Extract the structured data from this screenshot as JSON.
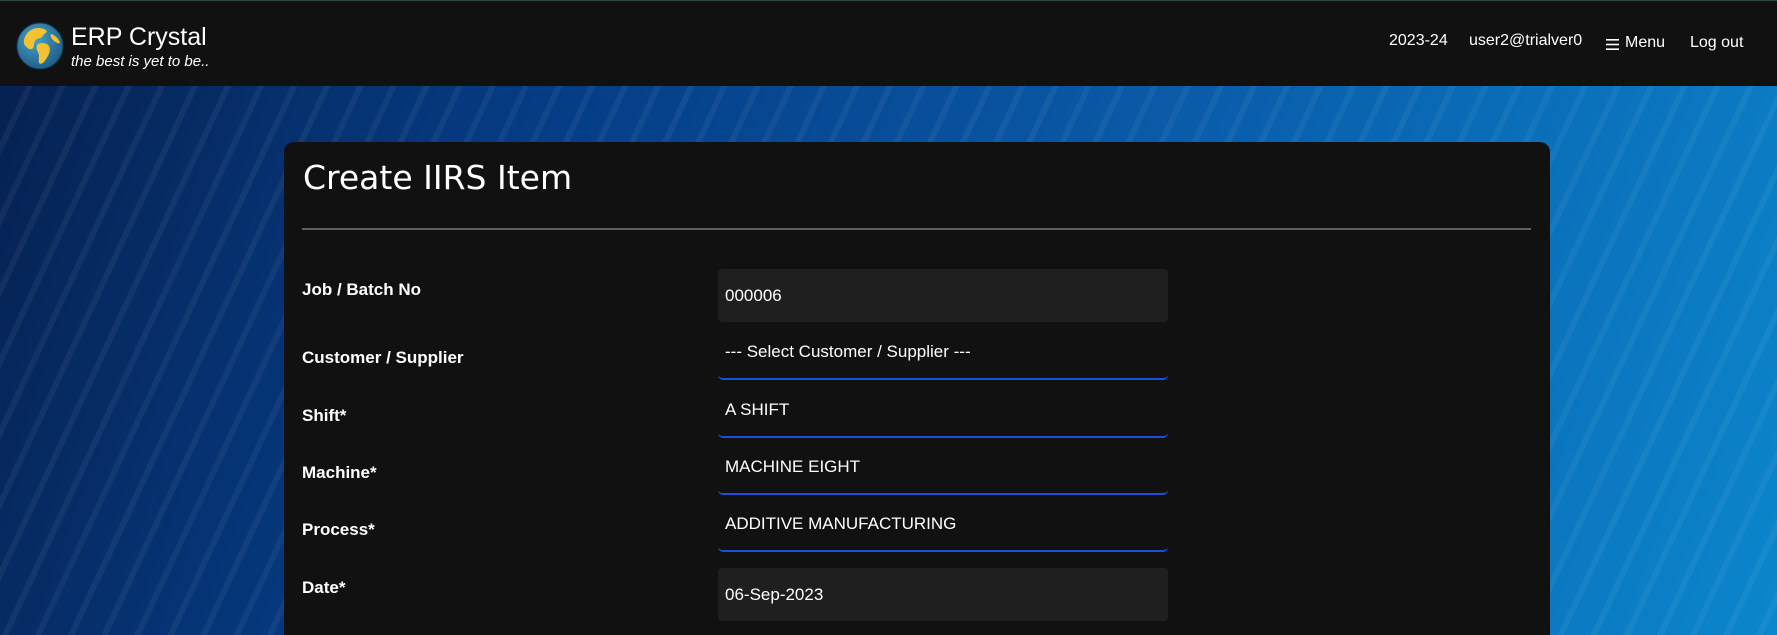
{
  "header": {
    "brand_title": "ERP Crystal",
    "brand_tagline": "the best is yet to be..",
    "logo_icon": "globe-icon",
    "financial_year": "2023-24",
    "user": "user2@trialver0",
    "menu_label": "Menu",
    "menu_icon": "hamburger-icon",
    "logout_label": "Log out"
  },
  "form": {
    "title": "Create IIRS Item",
    "fields": {
      "job_batch_no": {
        "label": "Job / Batch No",
        "value": "000006"
      },
      "customer_supplier": {
        "label": "Customer / Supplier",
        "value": "--- Select Customer / Supplier ---"
      },
      "shift": {
        "label": "Shift*",
        "value": "A SHIFT"
      },
      "machine": {
        "label": "Machine*",
        "value": "MACHINE EIGHT"
      },
      "process": {
        "label": "Process*",
        "value": "ADDITIVE MANUFACTURING"
      },
      "date": {
        "label": "Date*",
        "value": "06-Sep-2023"
      }
    }
  },
  "colors": {
    "topbar_bg": "#111111",
    "panel_bg": "#111111",
    "input_bg": "#1f1f1f",
    "select_underline": "#1b4fd8",
    "background_blue": "#0a5aa8"
  }
}
